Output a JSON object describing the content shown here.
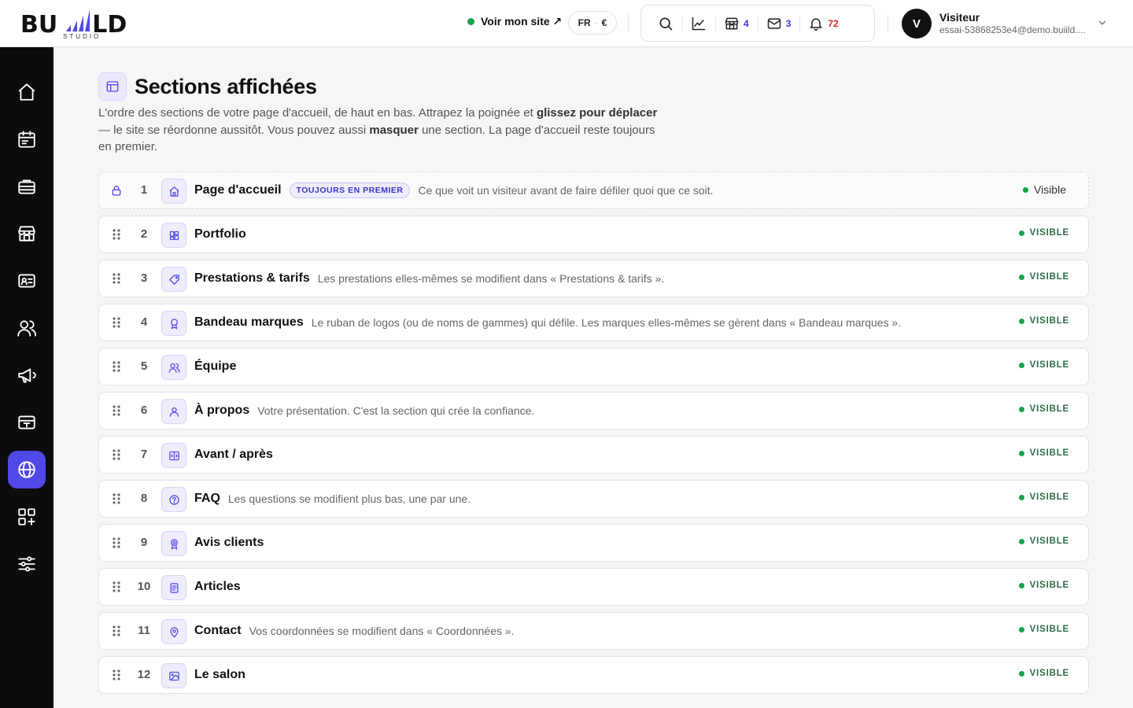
{
  "brand": {
    "word": "BUILD",
    "sub": "STUDIO"
  },
  "topbar": {
    "site_link": "Voir mon site ↗",
    "lang": "FR",
    "currency": "€",
    "counts": {
      "shop": "4",
      "mail": "3",
      "notifications": "72"
    }
  },
  "user": {
    "initial": "V",
    "name": "Visiteur",
    "email": "essai-53868253e4@demo.buiild...."
  },
  "page": {
    "title": "Sections affichées",
    "desc_1": "L'ordre des sections de votre page d'accueil, de haut en bas. Attrapez la poignée et ",
    "desc_b1": "glissez pour déplacer",
    "desc_2": " — le site se réordonne aussitôt. Vous pouvez aussi ",
    "desc_b2": "masquer",
    "desc_3": " une section. La page d'accueil reste toujours en premier."
  },
  "first_section": {
    "num": "1",
    "name": "Page d'accueil",
    "badge": "TOUJOURS EN PREMIER",
    "desc": "Ce que voit un visiteur avant de faire défiler quoi que ce soit.",
    "status": "Visible"
  },
  "sections": [
    {
      "num": "2",
      "name": "Portfolio",
      "desc": "",
      "status": "VISIBLE",
      "icon": "grid-icon"
    },
    {
      "num": "3",
      "name": "Prestations & tarifs",
      "desc": "Les prestations elles-mêmes se modifient dans « Prestations & tarifs ».",
      "status": "VISIBLE",
      "icon": "tag-icon"
    },
    {
      "num": "4",
      "name": "Bandeau marques",
      "desc": "Le ruban de logos (ou de noms de gammes) qui défile. Les marques elles-mêmes se gèrent dans « Bandeau marques ».",
      "status": "VISIBLE",
      "icon": "award-icon"
    },
    {
      "num": "5",
      "name": "Équipe",
      "desc": "",
      "status": "VISIBLE",
      "icon": "users-icon"
    },
    {
      "num": "6",
      "name": "À propos",
      "desc": "Votre présentation. C'est la section qui crée la confiance.",
      "status": "VISIBLE",
      "icon": "user-icon"
    },
    {
      "num": "7",
      "name": "Avant / après",
      "desc": "",
      "status": "VISIBLE",
      "icon": "compare-icon"
    },
    {
      "num": "8",
      "name": "FAQ",
      "desc": "Les questions se modifient plus bas, une par une.",
      "status": "VISIBLE",
      "icon": "help-icon"
    },
    {
      "num": "9",
      "name": "Avis clients",
      "desc": "",
      "status": "VISIBLE",
      "icon": "medal-icon"
    },
    {
      "num": "10",
      "name": "Articles",
      "desc": "",
      "status": "VISIBLE",
      "icon": "article-icon"
    },
    {
      "num": "11",
      "name": "Contact",
      "desc": "Vos coordonnées se modifient dans « Coordonnées ».",
      "status": "VISIBLE",
      "icon": "pin-icon"
    },
    {
      "num": "12",
      "name": "Le salon",
      "desc": "",
      "status": "VISIBLE",
      "icon": "image-icon"
    }
  ],
  "colors": {
    "accent": "#5148e8",
    "visible": "#16a34a",
    "notif": "#dc2626"
  }
}
